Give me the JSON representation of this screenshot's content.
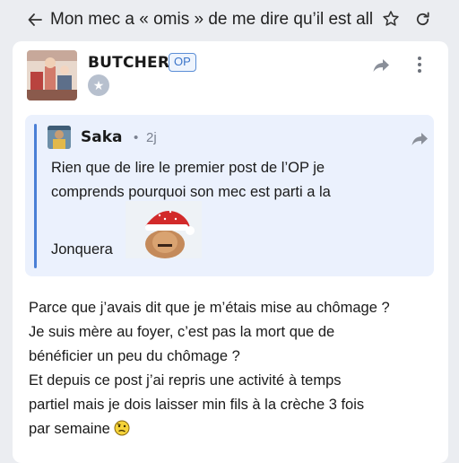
{
  "topbar": {
    "title": "Mon mec a « omis » de me dire qu’il est all",
    "back_icon": "arrow-left-icon",
    "star_icon": "star-outline-icon",
    "refresh_icon": "refresh-icon"
  },
  "post": {
    "author": "BUTCHER",
    "op_badge": "OP",
    "rank_icon": "star-badge-icon",
    "share_icon": "share-icon",
    "more_icon": "more-vertical-icon",
    "quote": {
      "author": "Saka",
      "separator": "•",
      "time": "2j",
      "share_icon": "share-icon",
      "lines": [
        "Rien que de lire le premier post de l’OP je",
        "comprends pourquoi son mec est parti a la"
      ],
      "last_line": "Jonquera"
    },
    "body_lines": [
      "Parce que j’avais dit que je m’étais mise au chômage ?",
      "Je suis mère au foyer, c’est pas la mort que de",
      "bénéficier un peu du chômage ?",
      "Et depuis ce post j’ai repris une activité à temps",
      "partiel mais je dois laisser min fils à la crèche 3 fois",
      "par semaine"
    ]
  },
  "colors": {
    "background": "#ebedf1",
    "card": "#ffffff",
    "quote_bg": "#ebf1fd",
    "accent_blue": "#4a7fd6",
    "muted": "#7a8190"
  }
}
